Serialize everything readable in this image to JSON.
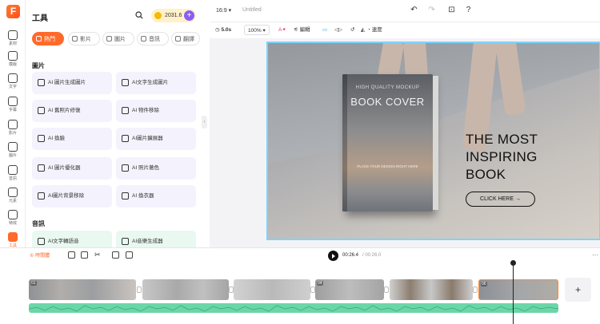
{
  "app": {
    "logo_letter": "F"
  },
  "rail": [
    {
      "label": "素材",
      "icon": "media-icon"
    },
    {
      "label": "模版",
      "icon": "template-icon"
    },
    {
      "label": "文字",
      "icon": "text-icon"
    },
    {
      "label": "字幕",
      "icon": "subtitle-icon"
    },
    {
      "label": "影片",
      "icon": "video-icon"
    },
    {
      "label": "圖片",
      "icon": "image-icon"
    },
    {
      "label": "音訊",
      "icon": "audio-icon"
    },
    {
      "label": "元素",
      "icon": "elements-icon"
    },
    {
      "label": "特效",
      "icon": "effects-icon"
    },
    {
      "label": "工具",
      "icon": "tools-icon",
      "active": true
    }
  ],
  "panel": {
    "title": "工具",
    "credits": "2031.6",
    "plus": "+",
    "tabs": [
      {
        "label": "熱門",
        "active": true
      },
      {
        "label": "影片"
      },
      {
        "label": "圖片"
      },
      {
        "label": "音訊"
      },
      {
        "label": "翻譯"
      }
    ],
    "sections": [
      {
        "title": "圖片",
        "tools": [
          "AI 圖片生成圖片",
          "AI文字生成圖片",
          "AI 舊照片修復",
          "AI 物件移除",
          "AI 換臉",
          "AI圖片擴展器",
          "AI 圖片優化器",
          "AI 照片著色",
          "AI圖片背景移除",
          "AI 換衣器"
        ]
      },
      {
        "title": "音訊",
        "tools": [
          "AI文字轉語音",
          "AI音樂生成器"
        ]
      }
    ]
  },
  "topbar": {
    "ratio": "16:9",
    "ratio_caret": "▾",
    "title_placeholder": "Untitled"
  },
  "toolbar": {
    "duration": "5.0s",
    "zoom": "100%",
    "zoom_caret": "▾",
    "edit": "編輯",
    "speed": "速度"
  },
  "canvas": {
    "book_small": "HIGH QUALITY MOCKUP",
    "book_title": "BOOK COVER",
    "book_foot": "PLACE YOUR DESIGN RIGHT HERE",
    "headline": [
      "THE MOST",
      "INSPIRING",
      "BOOK"
    ],
    "cta": "CLICK HERE  →"
  },
  "timeline": {
    "history": "時間體",
    "current_time": "00:26.4",
    "total_time": "/ 00:26.0",
    "more": "···",
    "add_clip": "+",
    "clips": [
      {
        "num": "01"
      },
      {
        "num": ""
      },
      {
        "num": ""
      },
      {
        "num": "04"
      },
      {
        "num": ""
      },
      {
        "num": "06",
        "selected": true
      }
    ]
  }
}
